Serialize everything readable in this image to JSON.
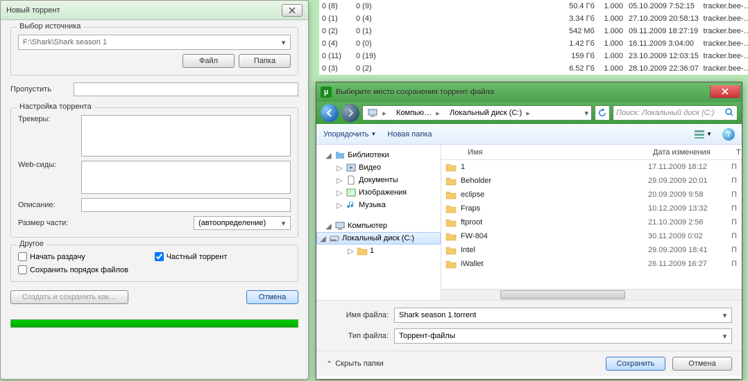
{
  "bg_rows": [
    {
      "c1": "0 (8)",
      "c2": "0 (9)",
      "c4": "50.4 Гб",
      "c5": "1.000",
      "c6": "05.10.2009 7:52:15",
      "c7": "tracker.bee-…"
    },
    {
      "c1": "0 (1)",
      "c2": "0 (4)",
      "c4": "3.34 Гб",
      "c5": "1.000",
      "c6": "27.10.2009 20:58:13",
      "c7": "tracker.bee-…"
    },
    {
      "c1": "0 (2)",
      "c2": "0 (1)",
      "c4": "542 Мб",
      "c5": "1.000",
      "c6": "09.11.2009 18:27:19",
      "c7": "tracker.bee-…"
    },
    {
      "c1": "0 (4)",
      "c2": "0 (0)",
      "c4": "1.42 Гб",
      "c5": "1.000",
      "c6": "16.11.2009 3:04:00",
      "c7": "tracker.bee-…"
    },
    {
      "c1": "0 (11)",
      "c2": "0 (19)",
      "c4": "159 Гб",
      "c5": "1.000",
      "c6": "23.10.2009 12:03:15",
      "c7": "tracker.bee-…"
    },
    {
      "c1": "0 (3)",
      "c2": "0 (2)",
      "c4": "6.52 Гб",
      "c5": "1.000",
      "c6": "28.10.2009 22:36:07",
      "c7": "tracker.bee-…"
    }
  ],
  "d1": {
    "title": "Новый торрент",
    "g1": "Выбор источника",
    "source": "F:\\Shark\\Shark season 1",
    "file": "Файл",
    "folder": "Папка",
    "skip": "Пропустить",
    "skip_val": "",
    "g2": "Настройка торрента",
    "trackers": "Трекеры:",
    "trackers_val": "",
    "webseeds": "Web-сиды:",
    "webseeds_val": "",
    "desc": "Описание:",
    "desc_val": "",
    "piece": "Размер части:",
    "piece_val": "(автоопределение)",
    "g3": "Другое",
    "cb1": "Начать раздачу",
    "cb2": "Частный торрент",
    "cb3": "Сохранить порядок файлов",
    "create": "Создать и сохранить как…",
    "cancel": "Отмена"
  },
  "d2": {
    "title": "Выберите место сохранения торрент-файла",
    "crumbs": [
      "Компью…",
      "Локальный диск (C:)"
    ],
    "search_ph": "Поиск: Локальный диск (C:)",
    "organize": "Упорядочить",
    "newfolder": "Новая папка",
    "tree": {
      "libs": "Библиотеки",
      "video": "Видео",
      "docs": "Документы",
      "images": "Изображения",
      "music": "Музыка",
      "computer": "Компьютер",
      "drive": "Локальный диск (C:)",
      "one": "1"
    },
    "hdr": {
      "name": "Имя",
      "date": "Дата изменения",
      "typ": "Т"
    },
    "files": [
      {
        "n": "1",
        "d": "17.11.2009 18:12",
        "t": "П"
      },
      {
        "n": "Beholder",
        "d": "29.09.2009 20:01",
        "t": "П"
      },
      {
        "n": "eclipse",
        "d": "20.09.2009 9:58",
        "t": "П"
      },
      {
        "n": "Fraps",
        "d": "10.12.2009 13:32",
        "t": "П"
      },
      {
        "n": "ftproot",
        "d": "21.10.2009 2:56",
        "t": "П"
      },
      {
        "n": "FW-804",
        "d": "30.11.2009 0:02",
        "t": "П"
      },
      {
        "n": "Intel",
        "d": "29.09.2009 18:41",
        "t": "П"
      },
      {
        "n": "iWallet",
        "d": "26.11.2009 16:27",
        "t": "П"
      }
    ],
    "fname_l": "Имя файла:",
    "fname": "Shark season 1.torrent",
    "ftype_l": "Тип файла:",
    "ftype": "Торрент-файлы",
    "hide": "Скрыть папки",
    "save": "Сохранить",
    "cancel": "Отмена"
  }
}
